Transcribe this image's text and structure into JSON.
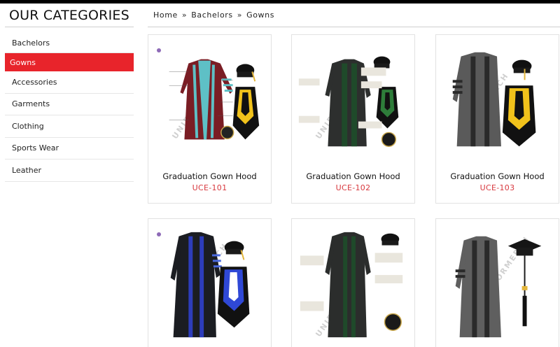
{
  "sidebar": {
    "title": "OUR CATEGORIES",
    "items": [
      {
        "label": "Bachelors",
        "active": false
      },
      {
        "label": "Gowns",
        "active": true
      },
      {
        "label": "Accessories",
        "active": false
      },
      {
        "label": "Garments",
        "active": false
      },
      {
        "label": "Clothing",
        "active": false
      },
      {
        "label": "Sports Wear",
        "active": false
      },
      {
        "label": "Leather",
        "active": false
      }
    ]
  },
  "breadcrumb": {
    "items": [
      "Home",
      "Bachelors",
      "Gowns"
    ],
    "separator": "»"
  },
  "products": [
    {
      "name": "Graduation Gown Hood",
      "sku": "UCE-101",
      "image": "maroon-gown-teal-hood-icon"
    },
    {
      "name": "Graduation Gown Hood",
      "sku": "UCE-102",
      "image": "black-green-gown-icon"
    },
    {
      "name": "Graduation Gown Hood",
      "sku": "UCE-103",
      "image": "grey-gown-gold-hood-icon"
    },
    {
      "name": "",
      "sku": "",
      "image": "black-blue-gown-icon"
    },
    {
      "name": "",
      "sku": "",
      "image": "black-green-gown-custom-icon"
    },
    {
      "name": "",
      "sku": "",
      "image": "grey-gown-cap-tassel-icon"
    }
  ],
  "colors": {
    "accent": "#e8242b",
    "sku": "#d8383e",
    "dot": "#8e6ab7"
  }
}
